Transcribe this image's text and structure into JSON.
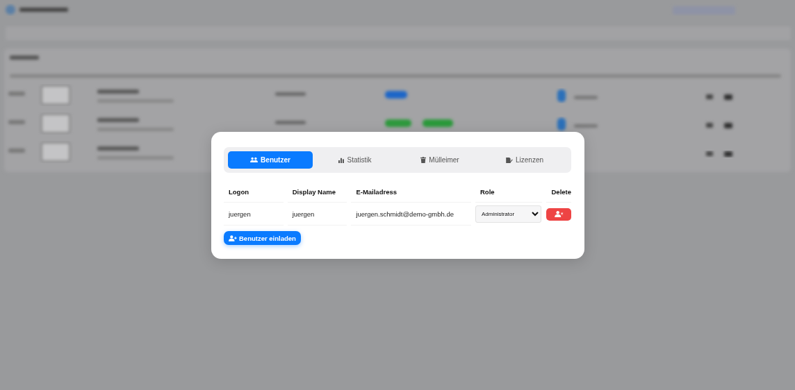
{
  "dialog": {
    "tabs": [
      {
        "label": "Benutzer",
        "selected": true
      },
      {
        "label": "Statistik",
        "selected": false
      },
      {
        "label": "Mülleimer",
        "selected": false
      },
      {
        "label": "Lizenzen",
        "selected": false
      }
    ],
    "table": {
      "columns": [
        "Logon",
        "Display Name",
        "E-Mailadress",
        "Role",
        "Delete"
      ],
      "rows": [
        {
          "logon": "juergen",
          "display_name": "juergen",
          "email": "juergen.schmidt@demo-gmbh.de",
          "role": "Administrator"
        }
      ]
    },
    "invite_button": "Benutzer einladen"
  }
}
